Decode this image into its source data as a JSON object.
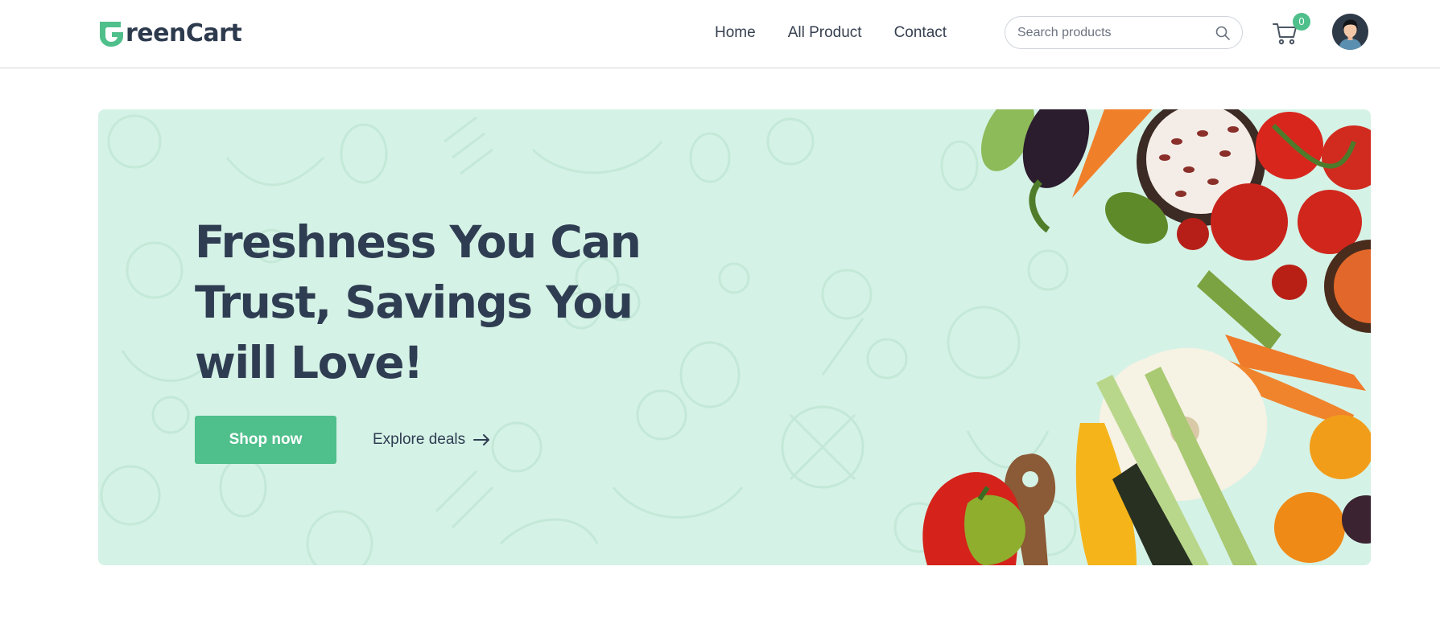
{
  "brand": {
    "name": "reenCart",
    "accent": "#4fbf8b",
    "text_color": "#2d3a4e"
  },
  "nav": {
    "links": [
      {
        "label": "Home"
      },
      {
        "label": "All Product"
      },
      {
        "label": "Contact"
      }
    ],
    "search": {
      "placeholder": "Search products",
      "icon": "search-icon"
    },
    "cart": {
      "icon": "cart-icon",
      "count": "0"
    },
    "avatar": {
      "icon": "user-avatar"
    }
  },
  "hero": {
    "background": "#d5f2e6",
    "title": "Freshness You Can Trust, Savings You will Love!",
    "primary_cta": "Shop now",
    "secondary_cta": "Explore deals",
    "secondary_icon": "arrow-right-icon"
  }
}
